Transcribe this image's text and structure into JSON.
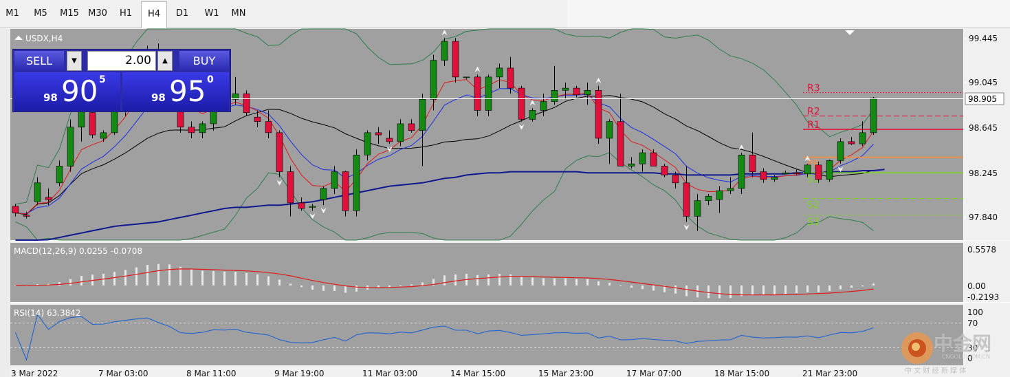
{
  "timeframes": [
    "M1",
    "M5",
    "M15",
    "M30",
    "H1",
    "H4",
    "D1",
    "W1",
    "MN"
  ],
  "active_timeframe": "H4",
  "symbol_label": "USDX,H4",
  "trade_panel": {
    "sell_label": "SELL",
    "buy_label": "BUY",
    "volume": "2.00",
    "sell_price_small": "98",
    "sell_price_big": "90",
    "sell_price_sup": "5",
    "buy_price_small": "98",
    "buy_price_big": "95",
    "buy_price_sup": "0"
  },
  "price_axis": {
    "ticks": [
      "99.445",
      "99.045",
      "98.645",
      "98.245",
      "97.840"
    ],
    "current_price": "98.905"
  },
  "pivot_labels": [
    "R3",
    "R2",
    "R1",
    "PP",
    "S1",
    "S2",
    "S3"
  ],
  "macd": {
    "label": "MACD(12,26,9) 0.0255 -0.0708",
    "ticks": [
      "0.5578",
      "0.00",
      "-0.2193"
    ]
  },
  "rsi": {
    "label": "RSI(14) 63.3842",
    "ticks": [
      "100",
      "70",
      "30",
      "0"
    ]
  },
  "time_axis": [
    "3 Mar 2022",
    "7 Mar 03:00",
    "8 Mar 11:00",
    "9 Mar 19:00",
    "11 Mar 03:00",
    "14 Mar 15:00",
    "15 Mar 23:00",
    "17 Mar 07:00",
    "18 Mar 15:00",
    "21 Mar 23:00"
  ],
  "watermark": {
    "title": "中金网",
    "url": "CNGOLD.COM.CN",
    "tagline": "中 文 财 经 新 媒 体"
  },
  "colors": {
    "chart_bg": "#a0a0a0",
    "bull": "#148a14",
    "bear": "#e0103c",
    "ma_fast": "#e01818",
    "ma_mid": "#1a2ee0",
    "ma_slow": "#000000",
    "ma_long": "#101890",
    "bollinger": "#2e7d4a",
    "pivot_r": "#e8103c",
    "pivot_pp": "#ff8c3c",
    "pivot_s": "#7ed321",
    "rsi_line": "#1e64d2",
    "macd_signal": "#e01818"
  },
  "chart_data": {
    "type": "candlestick",
    "symbol": "USDX",
    "timeframe": "H4",
    "ylim": [
      97.6,
      99.6
    ],
    "candles": [
      [
        97.94,
        97.96,
        97.85,
        97.88
      ],
      [
        97.86,
        97.89,
        97.83,
        97.85
      ],
      [
        97.98,
        98.2,
        97.95,
        98.15
      ],
      [
        98.02,
        98.1,
        97.95,
        98.0
      ],
      [
        98.15,
        98.35,
        98.12,
        98.3
      ],
      [
        98.3,
        98.72,
        98.25,
        98.65
      ],
      [
        98.65,
        98.88,
        98.52,
        98.8
      ],
      [
        98.78,
        98.82,
        98.55,
        98.58
      ],
      [
        98.55,
        98.62,
        98.52,
        98.6
      ],
      [
        98.6,
        98.85,
        98.58,
        98.82
      ],
      [
        98.82,
        99.05,
        98.75,
        98.98
      ],
      [
        98.98,
        99.25,
        98.9,
        99.2
      ],
      [
        99.2,
        99.38,
        99.0,
        99.35
      ],
      [
        99.3,
        99.4,
        99.15,
        99.18
      ],
      [
        99.17,
        99.2,
        98.95,
        99.0
      ],
      [
        99.0,
        99.05,
        98.6,
        98.65
      ],
      [
        98.65,
        98.7,
        98.55,
        98.6
      ],
      [
        98.6,
        98.7,
        98.55,
        98.68
      ],
      [
        98.68,
        98.95,
        98.62,
        98.9
      ],
      [
        98.95,
        99.05,
        98.8,
        98.88
      ],
      [
        98.9,
        99.1,
        98.85,
        98.95
      ],
      [
        98.95,
        98.98,
        98.75,
        98.78
      ],
      [
        98.74,
        98.8,
        98.65,
        98.7
      ],
      [
        98.7,
        98.8,
        98.55,
        98.6
      ],
      [
        98.6,
        98.62,
        98.2,
        98.25
      ],
      [
        98.25,
        98.3,
        97.85,
        97.97
      ],
      [
        97.97,
        98.02,
        97.9,
        97.92
      ],
      [
        97.93,
        97.96,
        97.9,
        97.94
      ],
      [
        98.0,
        98.12,
        97.95,
        98.1
      ],
      [
        98.1,
        98.3,
        98.05,
        98.25
      ],
      [
        98.25,
        98.26,
        97.85,
        97.9
      ],
      [
        97.9,
        98.45,
        97.85,
        98.4
      ],
      [
        98.4,
        98.62,
        98.35,
        98.6
      ],
      [
        98.6,
        98.65,
        98.5,
        98.58
      ],
      [
        98.55,
        98.62,
        98.5,
        98.52
      ],
      [
        98.52,
        98.72,
        98.48,
        98.68
      ],
      [
        98.68,
        98.72,
        98.6,
        98.62
      ],
      [
        98.62,
        98.95,
        98.3,
        98.9
      ],
      [
        98.9,
        99.3,
        98.8,
        99.25
      ],
      [
        99.25,
        99.45,
        99.2,
        99.42
      ],
      [
        99.42,
        99.45,
        99.05,
        99.1
      ],
      [
        99.1,
        99.1,
        99.08,
        99.1
      ],
      [
        99.1,
        99.12,
        98.75,
        98.8
      ],
      [
        98.8,
        99.12,
        98.75,
        99.1
      ],
      [
        99.1,
        99.22,
        99.0,
        99.18
      ],
      [
        99.18,
        99.28,
        98.95,
        99.0
      ],
      [
        99.0,
        99.02,
        98.7,
        98.72
      ],
      [
        98.72,
        98.82,
        98.7,
        98.8
      ],
      [
        98.8,
        98.95,
        98.75,
        98.88
      ],
      [
        98.88,
        99.2,
        98.85,
        98.98
      ],
      [
        98.98,
        99.05,
        98.9,
        99.0
      ],
      [
        99.0,
        99.02,
        98.92,
        98.94
      ],
      [
        98.94,
        99.05,
        98.85,
        98.98
      ],
      [
        98.98,
        99.02,
        98.5,
        98.55
      ],
      [
        98.55,
        98.72,
        98.32,
        98.7
      ],
      [
        98.7,
        98.95,
        98.35,
        98.3
      ],
      [
        98.3,
        98.38,
        98.28,
        98.32
      ],
      [
        98.32,
        98.45,
        98.25,
        98.42
      ],
      [
        98.42,
        98.45,
        98.3,
        98.3
      ],
      [
        98.3,
        98.32,
        98.2,
        98.22
      ],
      [
        98.22,
        98.25,
        98.1,
        98.15
      ],
      [
        98.15,
        98.3,
        97.8,
        97.85
      ],
      [
        97.85,
        98.05,
        97.72,
        97.99
      ],
      [
        97.99,
        98.05,
        97.95,
        98.03
      ],
      [
        98.0,
        98.12,
        97.88,
        98.08
      ],
      [
        98.08,
        98.2,
        98.05,
        98.1
      ],
      [
        98.1,
        98.42,
        98.05,
        98.4
      ],
      [
        98.4,
        98.6,
        98.2,
        98.25
      ],
      [
        98.25,
        98.28,
        98.15,
        98.18
      ],
      [
        98.18,
        98.22,
        98.16,
        98.2
      ],
      [
        98.23,
        98.26,
        98.23,
        98.24
      ],
      [
        98.24,
        98.27,
        98.22,
        98.23
      ],
      [
        98.23,
        98.32,
        98.2,
        98.31
      ],
      [
        98.31,
        98.34,
        98.15,
        98.18
      ],
      [
        98.18,
        98.36,
        98.16,
        98.35
      ],
      [
        98.35,
        98.55,
        98.32,
        98.52
      ],
      [
        98.52,
        98.56,
        98.49,
        98.5
      ],
      [
        98.5,
        98.7,
        98.48,
        98.6
      ],
      [
        98.6,
        98.92,
        98.58,
        98.91
      ]
    ],
    "ma_long": [
      97.58,
      97.6,
      97.62,
      97.64,
      97.66,
      97.68,
      97.7,
      97.72,
      97.74,
      97.76,
      97.77,
      97.78,
      97.79,
      97.8,
      97.82,
      97.84,
      97.86,
      97.88,
      97.9,
      97.92,
      97.93,
      97.93,
      97.94,
      97.95,
      97.95,
      97.96,
      97.97,
      97.98,
      98.0,
      98.02,
      98.04,
      98.06,
      98.08,
      98.1,
      98.12,
      98.13,
      98.14,
      98.15,
      98.17,
      98.19,
      98.2,
      98.22,
      98.23,
      98.24,
      98.24,
      98.25,
      98.25,
      98.25,
      98.25,
      98.25,
      98.25,
      98.25,
      98.24,
      98.24,
      98.24,
      98.24,
      98.24,
      98.24,
      98.24,
      98.23,
      98.23,
      98.22,
      98.22,
      98.22,
      98.22,
      98.22,
      98.23,
      98.23,
      98.23,
      98.23,
      98.23,
      98.24,
      98.24,
      98.24,
      98.25,
      98.25,
      98.25,
      98.26,
      98.26,
      98.27
    ]
  }
}
